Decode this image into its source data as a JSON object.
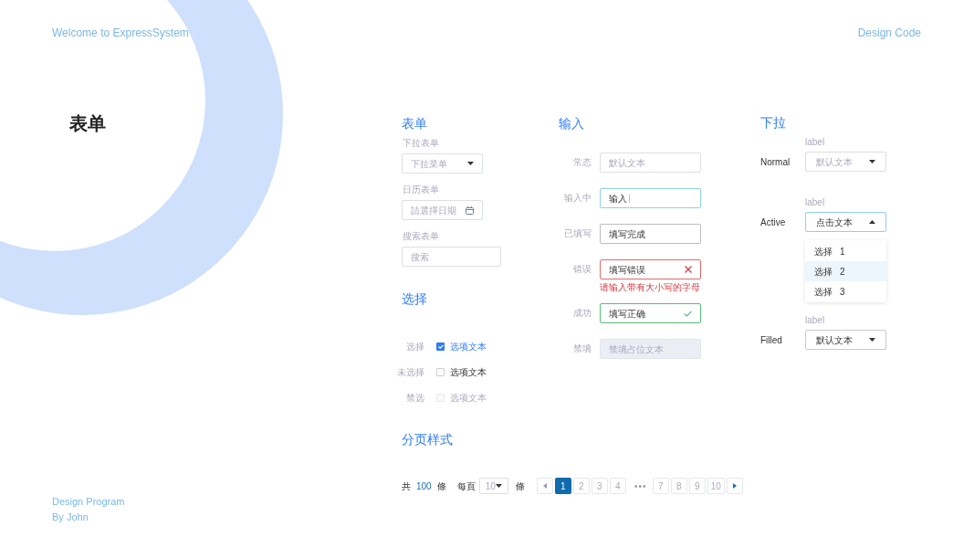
{
  "header": {
    "welcome": "Welcome to ExpressSystem",
    "link": "Design Code"
  },
  "page_title": "表单",
  "form_section": {
    "title": "表单",
    "fields": [
      {
        "kind": "select",
        "label": "下拉表单",
        "placeholder": "下拉菜单"
      },
      {
        "kind": "date",
        "label": "日历表单",
        "placeholder": "請選擇日期"
      },
      {
        "kind": "search",
        "label": "搜索表单",
        "placeholder": "搜索"
      }
    ]
  },
  "choice_section": {
    "title": "选择",
    "options": [
      {
        "label": "选择",
        "text": "选项文本",
        "checked": true,
        "disabled": false
      },
      {
        "label": "未选择",
        "text": "选项文本",
        "checked": false,
        "disabled": false
      },
      {
        "label": "禁选",
        "text": "选项文本",
        "checked": false,
        "disabled": true
      }
    ]
  },
  "pagination_section": {
    "title": "分页样式",
    "total_prefix": "共",
    "total": "100",
    "total_suffix": "條",
    "per_page_label": "每頁",
    "per_page": "10",
    "per_page_suffix": "條",
    "pages": [
      {
        "kind": "page",
        "label": "1",
        "selected": true
      },
      {
        "kind": "page",
        "label": "2",
        "selected": false
      },
      {
        "kind": "page",
        "label": "3",
        "selected": false
      },
      {
        "kind": "page",
        "label": "4",
        "selected": false
      },
      {
        "kind": "ellipsis",
        "label": "•••",
        "selected": false
      },
      {
        "kind": "page",
        "label": "7",
        "selected": false
      },
      {
        "kind": "page",
        "label": "8",
        "selected": false
      },
      {
        "kind": "page",
        "label": "9",
        "selected": false
      },
      {
        "kind": "page",
        "label": "10",
        "selected": false
      }
    ]
  },
  "input_section": {
    "title": "输入",
    "rows": [
      {
        "label": "常态",
        "kind": "normal",
        "placeholder": "默认文本"
      },
      {
        "label": "输入中",
        "kind": "focused",
        "value": "输入"
      },
      {
        "label": "已填写",
        "kind": "filled",
        "value": "填写完成"
      },
      {
        "label": "错误",
        "kind": "error",
        "value": "填写错误",
        "message": "请输入带有大小写的字母"
      },
      {
        "label": "成功",
        "kind": "success",
        "value": "填写正确"
      },
      {
        "label": "禁填",
        "kind": "disabled",
        "placeholder": "禁填占位文本"
      }
    ]
  },
  "dropdown_section": {
    "title": "下拉",
    "rows": [
      {
        "name": "Normal",
        "label": "label",
        "placeholder": "默认文本",
        "kind": "normal",
        "expanded": false
      },
      {
        "name": "Active",
        "label": "label",
        "value": "点击文本",
        "kind": "active",
        "expanded": true,
        "options": [
          {
            "text": "选择",
            "number": "1",
            "selected": false
          },
          {
            "text": "选择",
            "number": "2",
            "selected": true
          },
          {
            "text": "选择",
            "number": "3",
            "selected": false
          }
        ]
      },
      {
        "name": "Filled",
        "label": "label",
        "value": "默认文本",
        "kind": "filled",
        "expanded": false
      }
    ]
  },
  "footer": [
    "Design Program",
    "By John"
  ]
}
